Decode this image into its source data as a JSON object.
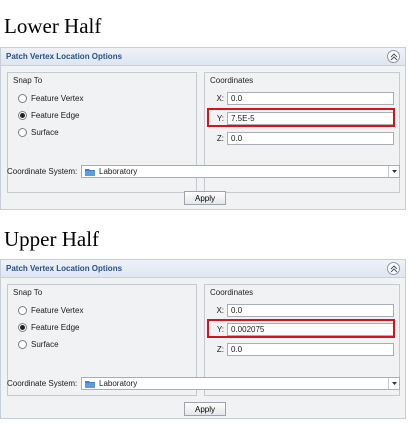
{
  "lower": {
    "heading": "Lower Half",
    "panel_title": "Patch Vertex Location Options",
    "snap_to": {
      "label": "Snap To",
      "options": [
        "Feature Vertex",
        "Feature Edge",
        "Surface"
      ],
      "selected": "Feature Edge"
    },
    "coordinates": {
      "label": "Coordinates",
      "x": {
        "axis": "X:",
        "value": "0.0"
      },
      "y": {
        "axis": "Y:",
        "value": "7.5E-5"
      },
      "z": {
        "axis": "Z:",
        "value": "0.0"
      }
    },
    "coordinate_system": {
      "label": "Coordinate System:",
      "value": "Laboratory"
    },
    "apply_label": "Apply"
  },
  "upper": {
    "heading": "Upper Half",
    "panel_title": "Patch Vertex Location Options",
    "snap_to": {
      "label": "Snap To",
      "options": [
        "Feature Vertex",
        "Feature Edge",
        "Surface"
      ],
      "selected": "Feature Edge"
    },
    "coordinates": {
      "label": "Coordinates",
      "x": {
        "axis": "X:",
        "value": "0.0"
      },
      "y": {
        "axis": "Y:",
        "value": "0.002075"
      },
      "z": {
        "axis": "Z:",
        "value": "0.0"
      }
    },
    "coordinate_system": {
      "label": "Coordinate System:",
      "value": "Laboratory"
    },
    "apply_label": "Apply"
  },
  "colors": {
    "panel_title": "#2a4f86",
    "highlight": "#d4141c",
    "panel_bg": "#f1f2f4"
  },
  "icons": {
    "collapse": "double-chevron-up-icon",
    "folder": "folder-icon",
    "dropdown": "dropdown-arrow-icon"
  }
}
